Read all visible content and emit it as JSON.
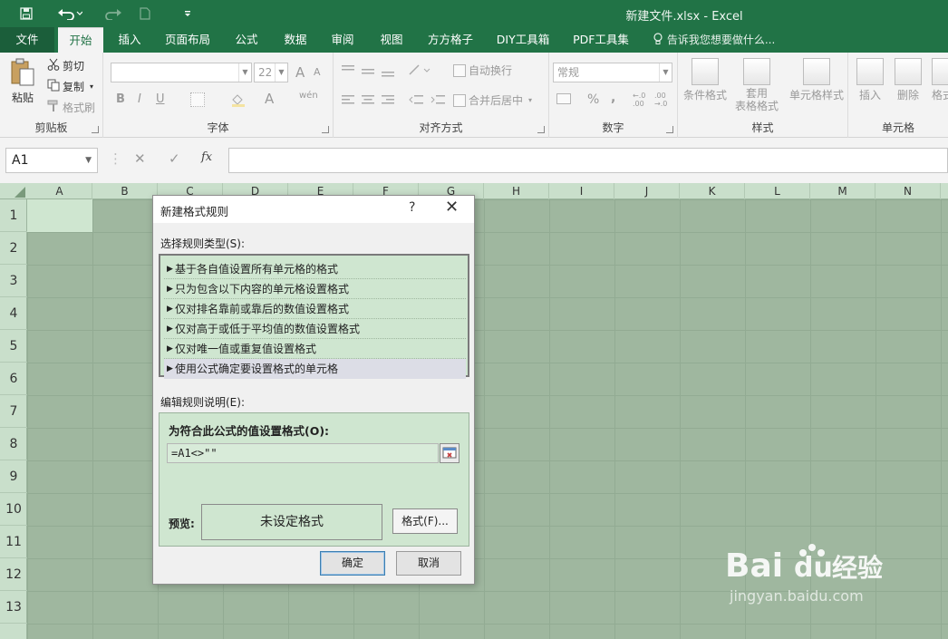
{
  "window": {
    "title": "新建文件.xlsx - Excel"
  },
  "tabs": [
    "文件",
    "开始",
    "插入",
    "页面布局",
    "公式",
    "数据",
    "审阅",
    "视图",
    "方方格子",
    "DIY工具箱",
    "PDF工具集"
  ],
  "tell_me": "告诉我您想要做什么...",
  "ribbon": {
    "clipboard": {
      "paste": "粘贴",
      "cut": "剪切",
      "copy": "复制",
      "format_painter": "格式刷",
      "label": "剪贴板"
    },
    "font": {
      "font_size": "22",
      "bold": "B",
      "italic": "I",
      "underline": "U",
      "grow": "A",
      "shrink": "A",
      "font_color": "A",
      "phonetic": "wén",
      "label": "字体"
    },
    "alignment": {
      "wrap": "自动换行",
      "merge": "合并后居中",
      "label": "对齐方式"
    },
    "number": {
      "format": "常规",
      "percent": "%",
      "comma": ",",
      "inc_dec": "←.0\n.00",
      "dec_dec": ".00\n→.0",
      "label": "数字"
    },
    "styles": {
      "conditional": "条件格式",
      "table": "套用\n表格格式",
      "cell_styles": "单元格样式",
      "label": "样式"
    },
    "cells": {
      "insert": "插入",
      "delete": "删除",
      "format": "格式",
      "label": "单元格"
    }
  },
  "formula_bar": {
    "name_box": "A1",
    "cancel": "✕",
    "enter": "✓",
    "fx": "fx"
  },
  "columns": [
    "A",
    "B",
    "C",
    "D",
    "E",
    "F",
    "G",
    "H",
    "I",
    "J",
    "K",
    "L",
    "M",
    "N"
  ],
  "rows": [
    "1",
    "2",
    "3",
    "4",
    "5",
    "6",
    "7",
    "8",
    "9",
    "10",
    "11",
    "12",
    "13"
  ],
  "dialog": {
    "title": "新建格式规则",
    "help": "?",
    "close": "✕",
    "rule_type_label": "选择规则类型(S):",
    "rule_types": [
      "基于各自值设置所有单元格的格式",
      "只为包含以下内容的单元格设置格式",
      "仅对排名靠前或靠后的数值设置格式",
      "仅对高于或低于平均值的数值设置格式",
      "仅对唯一值或重复值设置格式",
      "使用公式确定要设置格式的单元格"
    ],
    "edit_label": "编辑规则说明(E):",
    "formula_heading": "为符合此公式的值设置格式(O):",
    "formula_value": "=A1<>\"\"",
    "preview_label": "预览:",
    "preview_text": "未设定格式",
    "format_button": "格式(F)...",
    "ok": "确定",
    "cancel": "取消"
  },
  "watermark": {
    "brand": "Bai du 经验",
    "url": "jingyan.baidu.com"
  }
}
